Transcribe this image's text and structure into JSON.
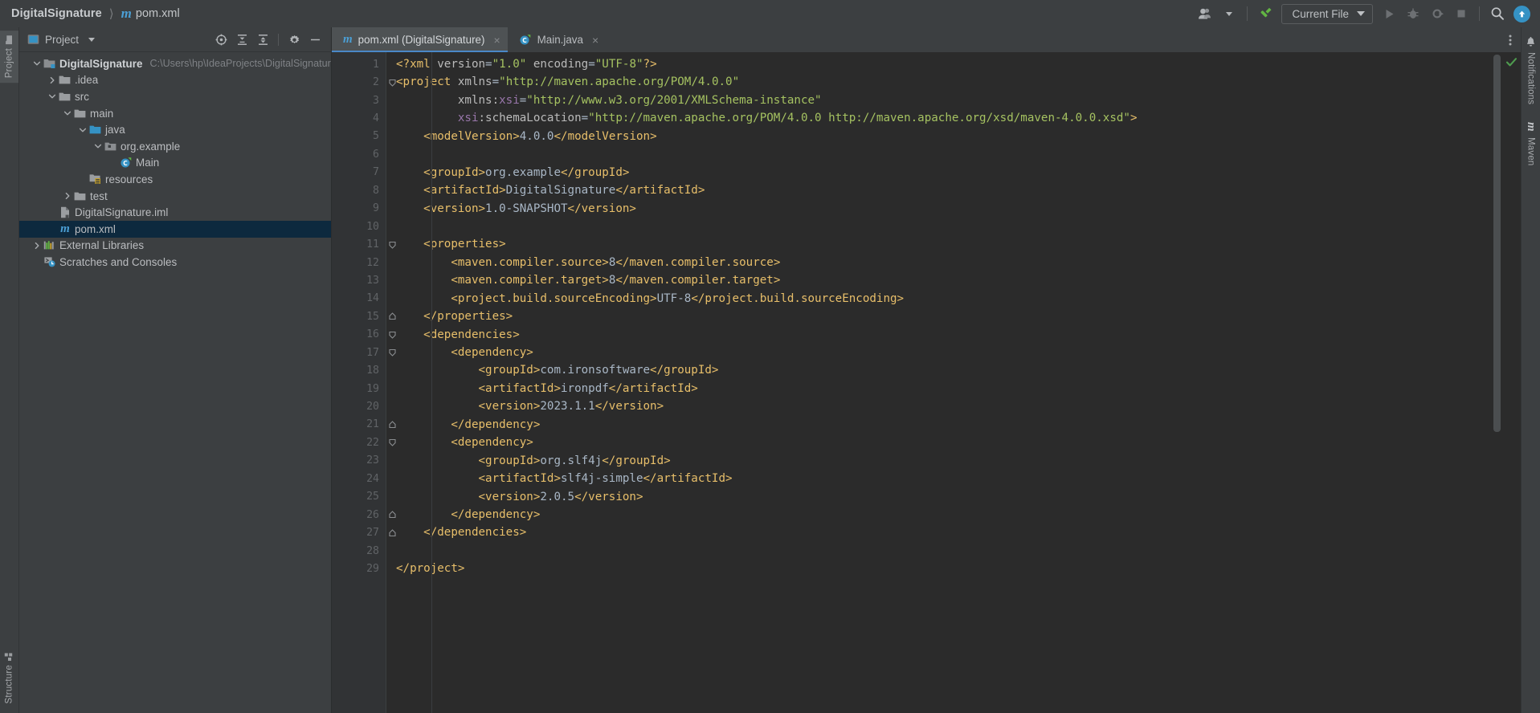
{
  "titlebar": {
    "project_name": "DigitalSignature",
    "separator": "⟩",
    "file_name": "pom.xml",
    "maven_glyph": "m",
    "run_config": "Current File",
    "buttons": {
      "user_label": "user-account",
      "build_label": "build",
      "run_label": "run",
      "debug_label": "debug",
      "coverage_label": "run-with-coverage",
      "stop_label": "stop",
      "search_label": "search-everywhere",
      "update_label": "update"
    }
  },
  "left_strip": {
    "top_tab": "Project",
    "bottom_tab": "Structure"
  },
  "right_strip": {
    "tabs": [
      "Notifications",
      "Maven"
    ],
    "maven_glyph": "m"
  },
  "project_panel": {
    "title": "Project",
    "toolbar": {
      "locate": "select-opened-file",
      "expand": "expand-all",
      "collapse": "collapse-all",
      "settings": "options",
      "hide": "hide"
    },
    "tree": [
      {
        "label": "DigitalSignature",
        "path": "C:\\Users\\hp\\IdeaProjects\\DigitalSignature",
        "depth": 0,
        "arrow": "down",
        "icon": "project-folder",
        "bold": true,
        "selected": false
      },
      {
        "label": ".idea",
        "path": "",
        "depth": 1,
        "arrow": "right",
        "icon": "folder",
        "bold": false,
        "selected": false
      },
      {
        "label": "src",
        "path": "",
        "depth": 1,
        "arrow": "down",
        "icon": "folder",
        "bold": false,
        "selected": false
      },
      {
        "label": "main",
        "path": "",
        "depth": 2,
        "arrow": "down",
        "icon": "folder",
        "bold": false,
        "selected": false
      },
      {
        "label": "java",
        "path": "",
        "depth": 3,
        "arrow": "down",
        "icon": "source-folder",
        "bold": false,
        "selected": false
      },
      {
        "label": "org.example",
        "path": "",
        "depth": 4,
        "arrow": "down",
        "icon": "package",
        "bold": false,
        "selected": false
      },
      {
        "label": "Main",
        "path": "",
        "depth": 5,
        "arrow": "none",
        "icon": "java-class",
        "bold": false,
        "selected": false
      },
      {
        "label": "resources",
        "path": "",
        "depth": 3,
        "arrow": "none",
        "icon": "resource-folder",
        "bold": false,
        "selected": false
      },
      {
        "label": "test",
        "path": "",
        "depth": 2,
        "arrow": "right",
        "icon": "folder",
        "bold": false,
        "selected": false
      },
      {
        "label": "DigitalSignature.iml",
        "path": "",
        "depth": 1,
        "arrow": "none",
        "icon": "iml-file",
        "bold": false,
        "selected": false
      },
      {
        "label": "pom.xml",
        "path": "",
        "depth": 1,
        "arrow": "none",
        "icon": "maven-file",
        "bold": false,
        "selected": true
      },
      {
        "label": "External Libraries",
        "path": "",
        "depth": 0,
        "arrow": "right",
        "icon": "libraries",
        "bold": false,
        "selected": false
      },
      {
        "label": "Scratches and Consoles",
        "path": "",
        "depth": 0,
        "arrow": "none",
        "icon": "scratches",
        "bold": false,
        "selected": false
      }
    ]
  },
  "editor": {
    "tabs": [
      {
        "label": "pom.xml (DigitalSignature)",
        "icon": "maven-file",
        "active": true,
        "close": "×"
      },
      {
        "label": "Main.java",
        "icon": "java-class",
        "active": false,
        "close": "×"
      }
    ],
    "inspection_status": "no-problems",
    "line_numbers": [
      1,
      2,
      3,
      4,
      5,
      6,
      7,
      8,
      9,
      10,
      11,
      12,
      13,
      14,
      15,
      16,
      17,
      18,
      19,
      20,
      21,
      22,
      23,
      24,
      25,
      26,
      27,
      28,
      29
    ],
    "folds": {
      "2": "open-start",
      "11": "open-start",
      "15": "open-end",
      "16": "open-start",
      "17": "open-start",
      "21": "open-end",
      "22": "open-start",
      "26": "open-end",
      "27": "open-end"
    },
    "code": [
      {
        "n": 1,
        "segs": [
          {
            "t": "<?xml ",
            "c": "pi"
          },
          {
            "t": "version",
            "c": "an"
          },
          {
            "t": "=",
            "c": "tx"
          },
          {
            "t": "\"1.0\"",
            "c": "av"
          },
          {
            "t": " ",
            "c": "tx"
          },
          {
            "t": "encoding",
            "c": "an"
          },
          {
            "t": "=",
            "c": "tx"
          },
          {
            "t": "\"UTF-8\"",
            "c": "av"
          },
          {
            "t": "?>",
            "c": "pi"
          }
        ]
      },
      {
        "n": 2,
        "segs": [
          {
            "t": "<project",
            "c": "tg"
          },
          {
            "t": " ",
            "c": "tx"
          },
          {
            "t": "xmlns",
            "c": "an"
          },
          {
            "t": "=",
            "c": "tx"
          },
          {
            "t": "\"http://maven.apache.org/POM/4.0.0\"",
            "c": "av"
          }
        ]
      },
      {
        "n": 3,
        "segs": [
          {
            "t": "         ",
            "c": "tx"
          },
          {
            "t": "xmlns:",
            "c": "an"
          },
          {
            "t": "xsi",
            "c": "ns"
          },
          {
            "t": "=",
            "c": "tx"
          },
          {
            "t": "\"http://www.w3.org/2001/XMLSchema-instance\"",
            "c": "av"
          }
        ]
      },
      {
        "n": 4,
        "segs": [
          {
            "t": "         ",
            "c": "tx"
          },
          {
            "t": "xsi",
            "c": "ns"
          },
          {
            "t": ":schemaLocation",
            "c": "an"
          },
          {
            "t": "=",
            "c": "tx"
          },
          {
            "t": "\"http://maven.apache.org/POM/4.0.0 http://maven.apache.org/xsd/maven-4.0.0.xsd\"",
            "c": "av"
          },
          {
            "t": ">",
            "c": "tg"
          }
        ]
      },
      {
        "n": 5,
        "segs": [
          {
            "t": "    ",
            "c": "tx"
          },
          {
            "t": "<modelVersion>",
            "c": "tg"
          },
          {
            "t": "4.0.0",
            "c": "tx"
          },
          {
            "t": "</modelVersion>",
            "c": "tg"
          }
        ]
      },
      {
        "n": 6,
        "segs": []
      },
      {
        "n": 7,
        "segs": [
          {
            "t": "    ",
            "c": "tx"
          },
          {
            "t": "<groupId>",
            "c": "tg"
          },
          {
            "t": "org.example",
            "c": "tx"
          },
          {
            "t": "</groupId>",
            "c": "tg"
          }
        ]
      },
      {
        "n": 8,
        "segs": [
          {
            "t": "    ",
            "c": "tx"
          },
          {
            "t": "<artifactId>",
            "c": "tg"
          },
          {
            "t": "DigitalSignature",
            "c": "tx"
          },
          {
            "t": "</artifactId>",
            "c": "tg"
          }
        ]
      },
      {
        "n": 9,
        "segs": [
          {
            "t": "    ",
            "c": "tx"
          },
          {
            "t": "<version>",
            "c": "tg"
          },
          {
            "t": "1.0-SNAPSHOT",
            "c": "tx"
          },
          {
            "t": "</version>",
            "c": "tg"
          }
        ]
      },
      {
        "n": 10,
        "segs": []
      },
      {
        "n": 11,
        "segs": [
          {
            "t": "    ",
            "c": "tx"
          },
          {
            "t": "<properties>",
            "c": "tg"
          }
        ]
      },
      {
        "n": 12,
        "segs": [
          {
            "t": "        ",
            "c": "tx"
          },
          {
            "t": "<maven.compiler.source>",
            "c": "tg"
          },
          {
            "t": "8",
            "c": "tx"
          },
          {
            "t": "</maven.compiler.source>",
            "c": "tg"
          }
        ]
      },
      {
        "n": 13,
        "segs": [
          {
            "t": "        ",
            "c": "tx"
          },
          {
            "t": "<maven.compiler.target>",
            "c": "tg"
          },
          {
            "t": "8",
            "c": "tx"
          },
          {
            "t": "</maven.compiler.target>",
            "c": "tg"
          }
        ]
      },
      {
        "n": 14,
        "segs": [
          {
            "t": "        ",
            "c": "tx"
          },
          {
            "t": "<project.build.sourceEncoding>",
            "c": "tg"
          },
          {
            "t": "UTF-8",
            "c": "tx"
          },
          {
            "t": "</project.build.sourceEncoding>",
            "c": "tg"
          }
        ]
      },
      {
        "n": 15,
        "segs": [
          {
            "t": "    ",
            "c": "tx"
          },
          {
            "t": "</properties>",
            "c": "tg"
          }
        ]
      },
      {
        "n": 16,
        "segs": [
          {
            "t": "    ",
            "c": "tx"
          },
          {
            "t": "<dependencies>",
            "c": "tg"
          }
        ]
      },
      {
        "n": 17,
        "segs": [
          {
            "t": "        ",
            "c": "tx"
          },
          {
            "t": "<dependency>",
            "c": "tg"
          }
        ]
      },
      {
        "n": 18,
        "segs": [
          {
            "t": "            ",
            "c": "tx"
          },
          {
            "t": "<groupId>",
            "c": "tg"
          },
          {
            "t": "com.ironsoftware",
            "c": "tx"
          },
          {
            "t": "</groupId>",
            "c": "tg"
          }
        ]
      },
      {
        "n": 19,
        "segs": [
          {
            "t": "            ",
            "c": "tx"
          },
          {
            "t": "<artifactId>",
            "c": "tg"
          },
          {
            "t": "ironpdf",
            "c": "tx"
          },
          {
            "t": "</artifactId>",
            "c": "tg"
          }
        ]
      },
      {
        "n": 20,
        "segs": [
          {
            "t": "            ",
            "c": "tx"
          },
          {
            "t": "<version>",
            "c": "tg"
          },
          {
            "t": "2023.1.1",
            "c": "tx"
          },
          {
            "t": "</version>",
            "c": "tg"
          }
        ]
      },
      {
        "n": 21,
        "segs": [
          {
            "t": "        ",
            "c": "tx"
          },
          {
            "t": "</dependency>",
            "c": "tg"
          }
        ]
      },
      {
        "n": 22,
        "segs": [
          {
            "t": "        ",
            "c": "tx"
          },
          {
            "t": "<dependency>",
            "c": "tg"
          }
        ]
      },
      {
        "n": 23,
        "segs": [
          {
            "t": "            ",
            "c": "tx"
          },
          {
            "t": "<groupId>",
            "c": "tg"
          },
          {
            "t": "org.slf4j",
            "c": "tx"
          },
          {
            "t": "</groupId>",
            "c": "tg"
          }
        ]
      },
      {
        "n": 24,
        "segs": [
          {
            "t": "            ",
            "c": "tx"
          },
          {
            "t": "<artifactId>",
            "c": "tg"
          },
          {
            "t": "slf4j-simple",
            "c": "tx"
          },
          {
            "t": "</artifactId>",
            "c": "tg"
          }
        ]
      },
      {
        "n": 25,
        "segs": [
          {
            "t": "            ",
            "c": "tx"
          },
          {
            "t": "<version>",
            "c": "tg"
          },
          {
            "t": "2.0.5",
            "c": "tx"
          },
          {
            "t": "</version>",
            "c": "tg"
          }
        ]
      },
      {
        "n": 26,
        "segs": [
          {
            "t": "        ",
            "c": "tx"
          },
          {
            "t": "</dependency>",
            "c": "tg"
          }
        ]
      },
      {
        "n": 27,
        "segs": [
          {
            "t": "    ",
            "c": "tx"
          },
          {
            "t": "</dependencies>",
            "c": "tg"
          }
        ]
      },
      {
        "n": 28,
        "segs": []
      },
      {
        "n": 29,
        "segs": [
          {
            "t": "</project>",
            "c": "tg"
          }
        ]
      }
    ]
  },
  "colors": {
    "chrome": "#3c3f41",
    "editor_bg": "#2b2b2b",
    "gutter_bg": "#313335",
    "selection": "#0d293e",
    "accent_blue": "#4a88c7",
    "tag": "#e8bf6a",
    "attr_value": "#a5c261",
    "namespace": "#9876aa",
    "text": "#a9b7c6",
    "ok_green": "#4f9c4f"
  }
}
